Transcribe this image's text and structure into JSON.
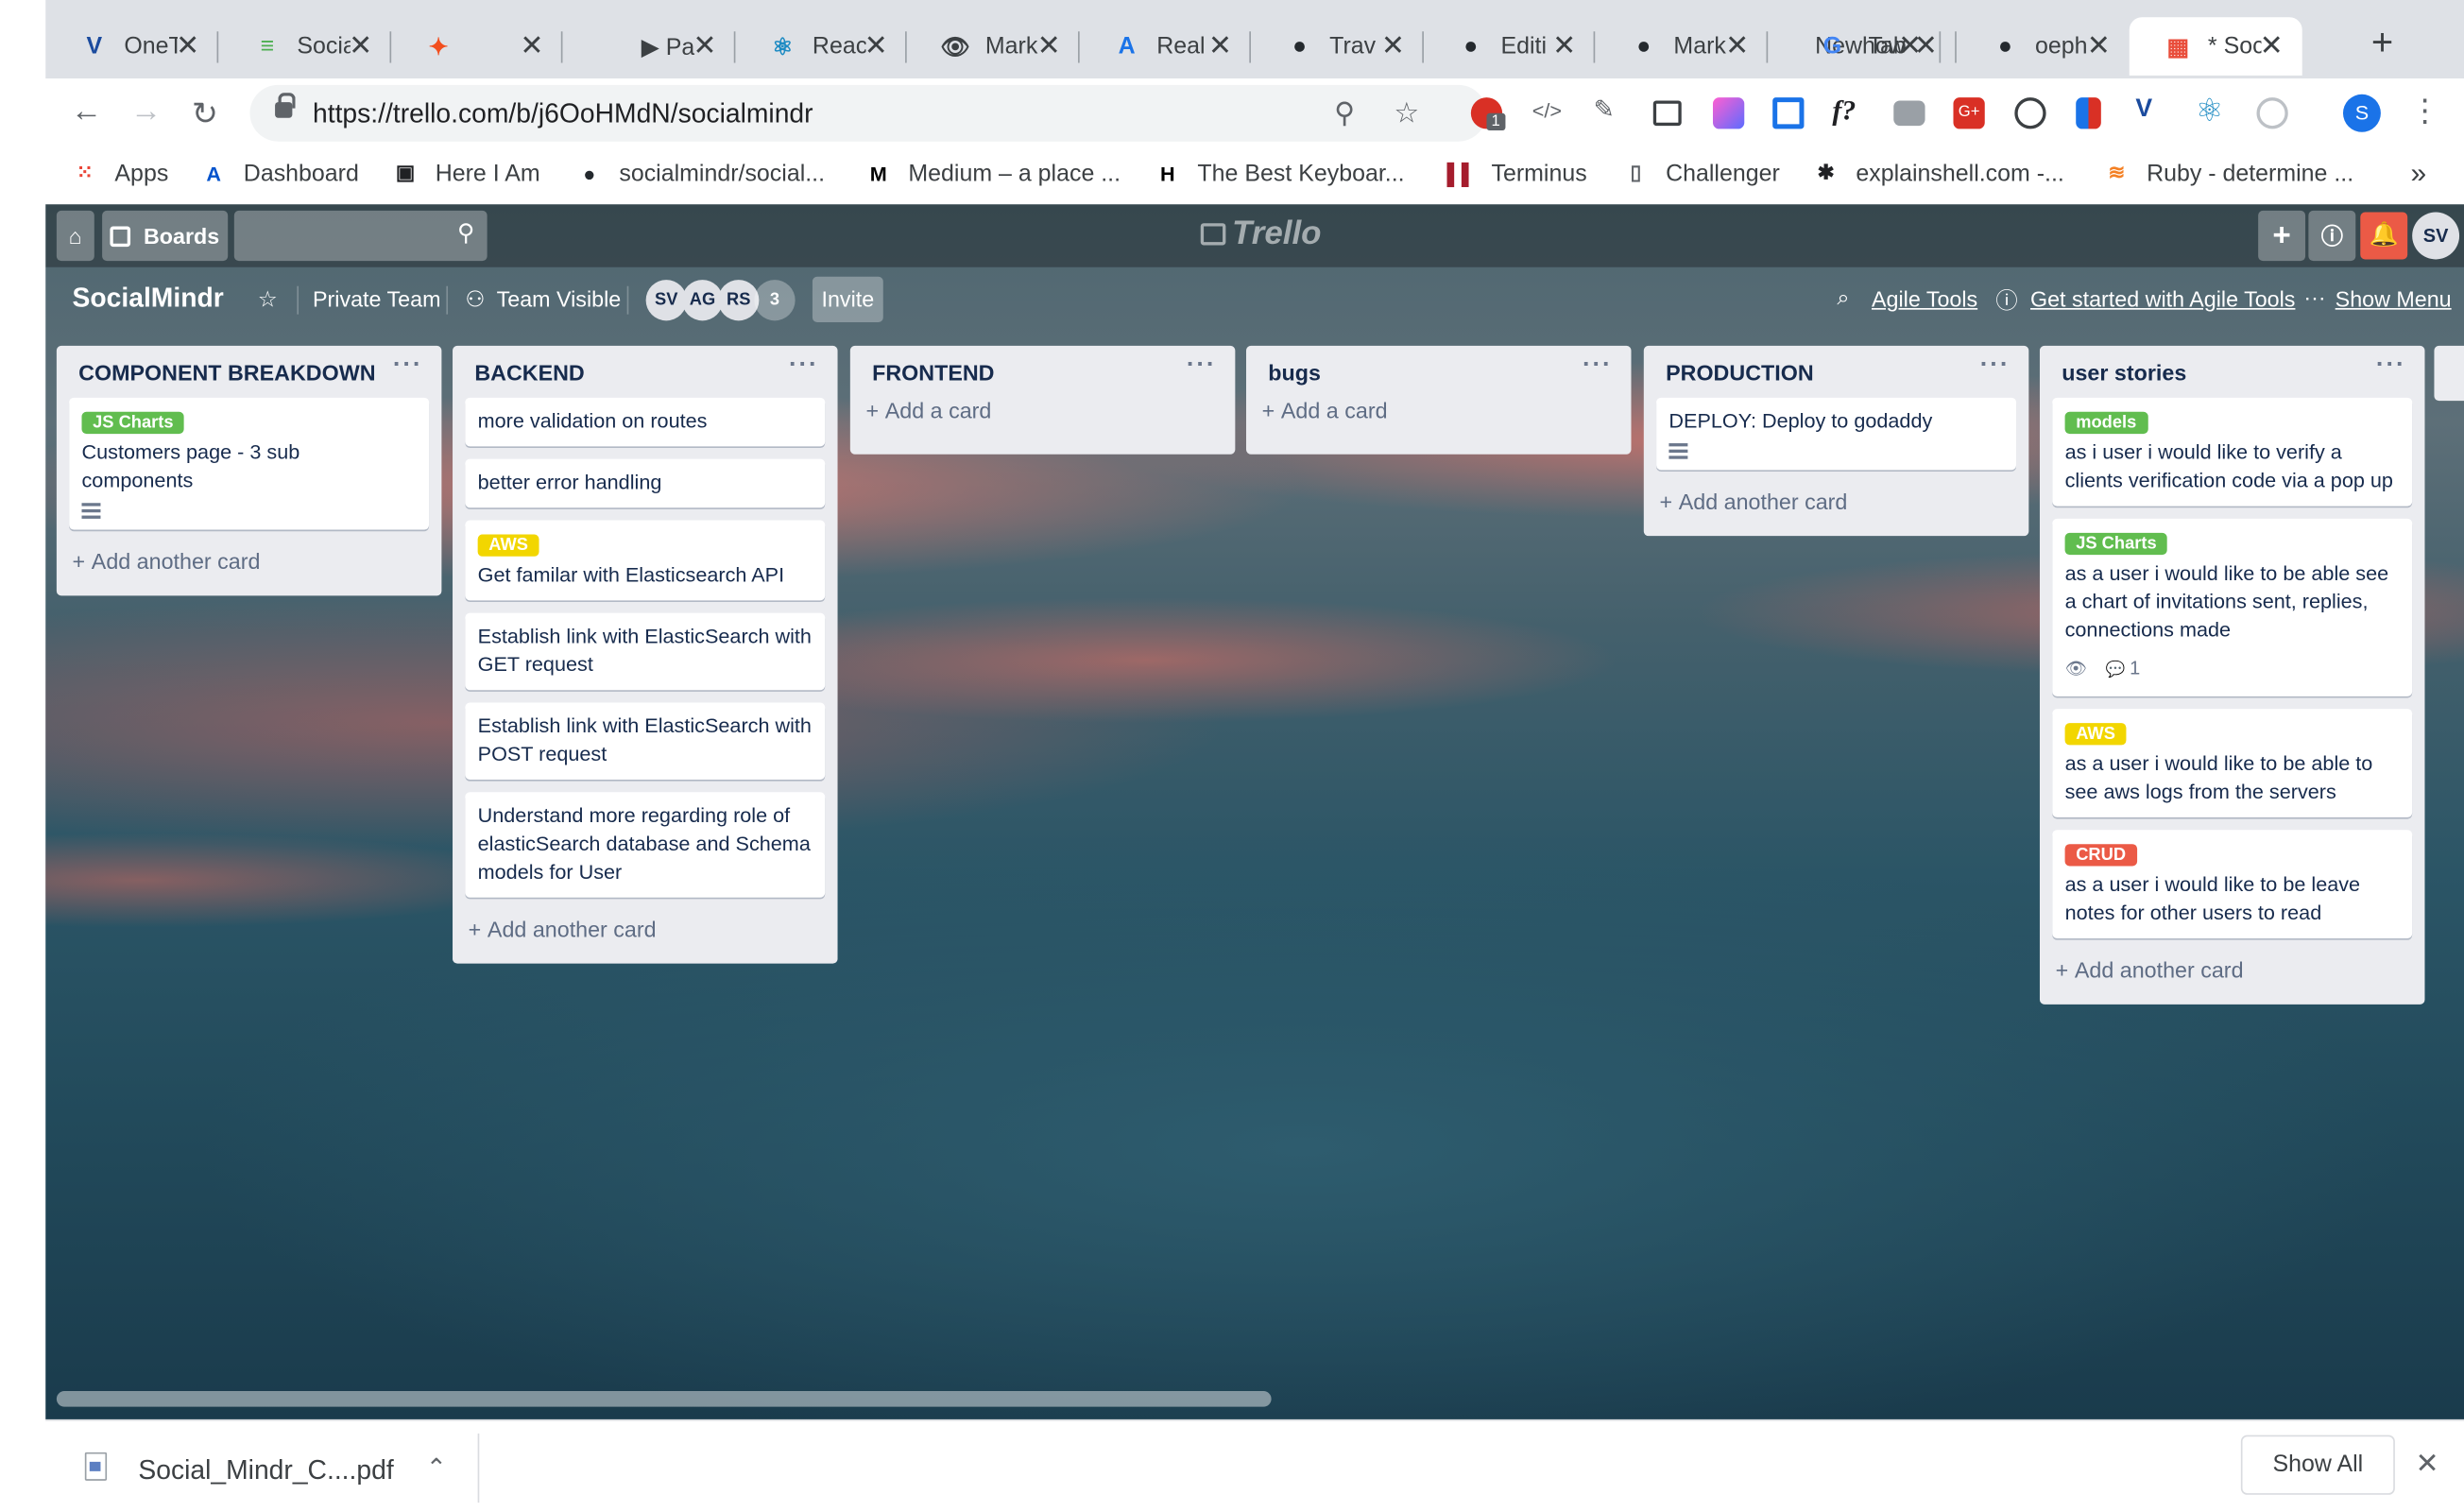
{
  "browser": {
    "tabs": [
      {
        "title": "OneT",
        "icon": "V",
        "icon_color": "#1b4b9e"
      },
      {
        "title": "Socia",
        "icon": "≡",
        "icon_color": "#4caf50"
      },
      {
        "title": "",
        "icon": "✦",
        "icon_color": "#f24e1e"
      },
      {
        "title": "▶ Pa",
        "icon": "",
        "icon_color": "#3c4043"
      },
      {
        "title": "Reac",
        "icon": "⚛",
        "icon_color": "#1e8bc3"
      },
      {
        "title": "Mark",
        "icon": "👁",
        "icon_color": "#3c4043"
      },
      {
        "title": "Real",
        "icon": "A",
        "icon_color": "#1a73e8"
      },
      {
        "title": "Trav",
        "icon": "●",
        "icon_color": "#24292e"
      },
      {
        "title": "Editi",
        "icon": "●",
        "icon_color": "#24292e"
      },
      {
        "title": "Mark",
        "icon": "●",
        "icon_color": "#24292e"
      },
      {
        "title": "New Tab",
        "icon": "",
        "icon_color": "#3c4043"
      },
      {
        "title": "how",
        "icon": "G",
        "icon_color": "#4285f4"
      },
      {
        "title": "oeph",
        "icon": "●",
        "icon_color": "#24292e"
      },
      {
        "title": "* Soc",
        "icon": "▦",
        "icon_color": "#e94e3c"
      }
    ],
    "url": "https://trello.com/b/j6OoHMdN/socialmindr",
    "profile_initial": "S",
    "ext_badge": "1",
    "bookmarks": [
      {
        "label": "Apps",
        "icon": "grid-icon"
      },
      {
        "label": "Dashboard",
        "icon": "atlassian-icon"
      },
      {
        "label": "Here I Am",
        "icon": "calendar-icon"
      },
      {
        "label": "socialmindr/social...",
        "icon": "github-icon"
      },
      {
        "label": "Medium – a place ...",
        "icon": "medium-icon"
      },
      {
        "label": "The Best Keyboar...",
        "icon": "htg-icon"
      },
      {
        "label": "Terminus",
        "icon": "terminus-icon"
      },
      {
        "label": "Challenger",
        "icon": "file-icon"
      },
      {
        "label": "explainshell.com -...",
        "icon": "shell-icon"
      },
      {
        "label": "Ruby - determine ...",
        "icon": "stackoverflow-icon"
      }
    ],
    "bookmarks_more": "»"
  },
  "trello": {
    "header": {
      "boards_label": "Boards",
      "logo": "Trello",
      "user_initials": "SV"
    },
    "board": {
      "name": "SocialMindr",
      "team": "Private Team",
      "visibility": "Team Visible",
      "members": [
        "SV",
        "AG",
        "RS"
      ],
      "member_count": "3",
      "invite": "Invite",
      "agile_tools": "Agile Tools",
      "get_started": "Get started with Agile Tools",
      "show_menu": "Show Menu"
    },
    "lists": [
      {
        "title": "COMPONENT BREAKDOWN",
        "cards": [
          {
            "label": "JS Charts",
            "label_color": "green",
            "text": "Customers page - 3 sub components",
            "description": true
          }
        ],
        "add": "Add another card"
      },
      {
        "title": "BACKEND",
        "cards": [
          {
            "text": "more validation on routes"
          },
          {
            "text": "better error handling"
          },
          {
            "label": "AWS",
            "label_color": "yellow",
            "text": "Get familar with Elasticsearch API"
          },
          {
            "text": "Establish link with ElasticSearch with GET request"
          },
          {
            "text": "Establish link with ElasticSearch with POST request"
          },
          {
            "text": "Understand more regarding role of elasticSearch database and Schema models for User"
          }
        ],
        "add": "Add another card"
      },
      {
        "title": "FRONTEND",
        "cards": [],
        "add": "Add a card"
      },
      {
        "title": "bugs",
        "cards": [],
        "add": "Add a card"
      },
      {
        "title": "PRODUCTION",
        "cards": [
          {
            "text": "DEPLOY: Deploy to godaddy",
            "description": true
          }
        ],
        "add": "Add another card"
      },
      {
        "title": "user stories",
        "cards": [
          {
            "label": "models",
            "label_color": "green",
            "text": "as i user i would like to verify a clients verification code via a pop up"
          },
          {
            "label": "JS Charts",
            "label_color": "green",
            "text": "as a user i would like to be able see a chart of invitations sent, replies, connections made",
            "watch": true,
            "comments": "1"
          },
          {
            "label": "AWS",
            "label_color": "yellow",
            "text": "as a user i would like to be able to see aws logs from the servers"
          },
          {
            "label": "CRUD",
            "label_color": "red",
            "text": "as a user i would like to be leave notes for other users to read"
          }
        ],
        "add": "Add another card"
      }
    ]
  },
  "downloads": {
    "file": "Social_Mindr_C....pdf",
    "show_all": "Show All"
  }
}
